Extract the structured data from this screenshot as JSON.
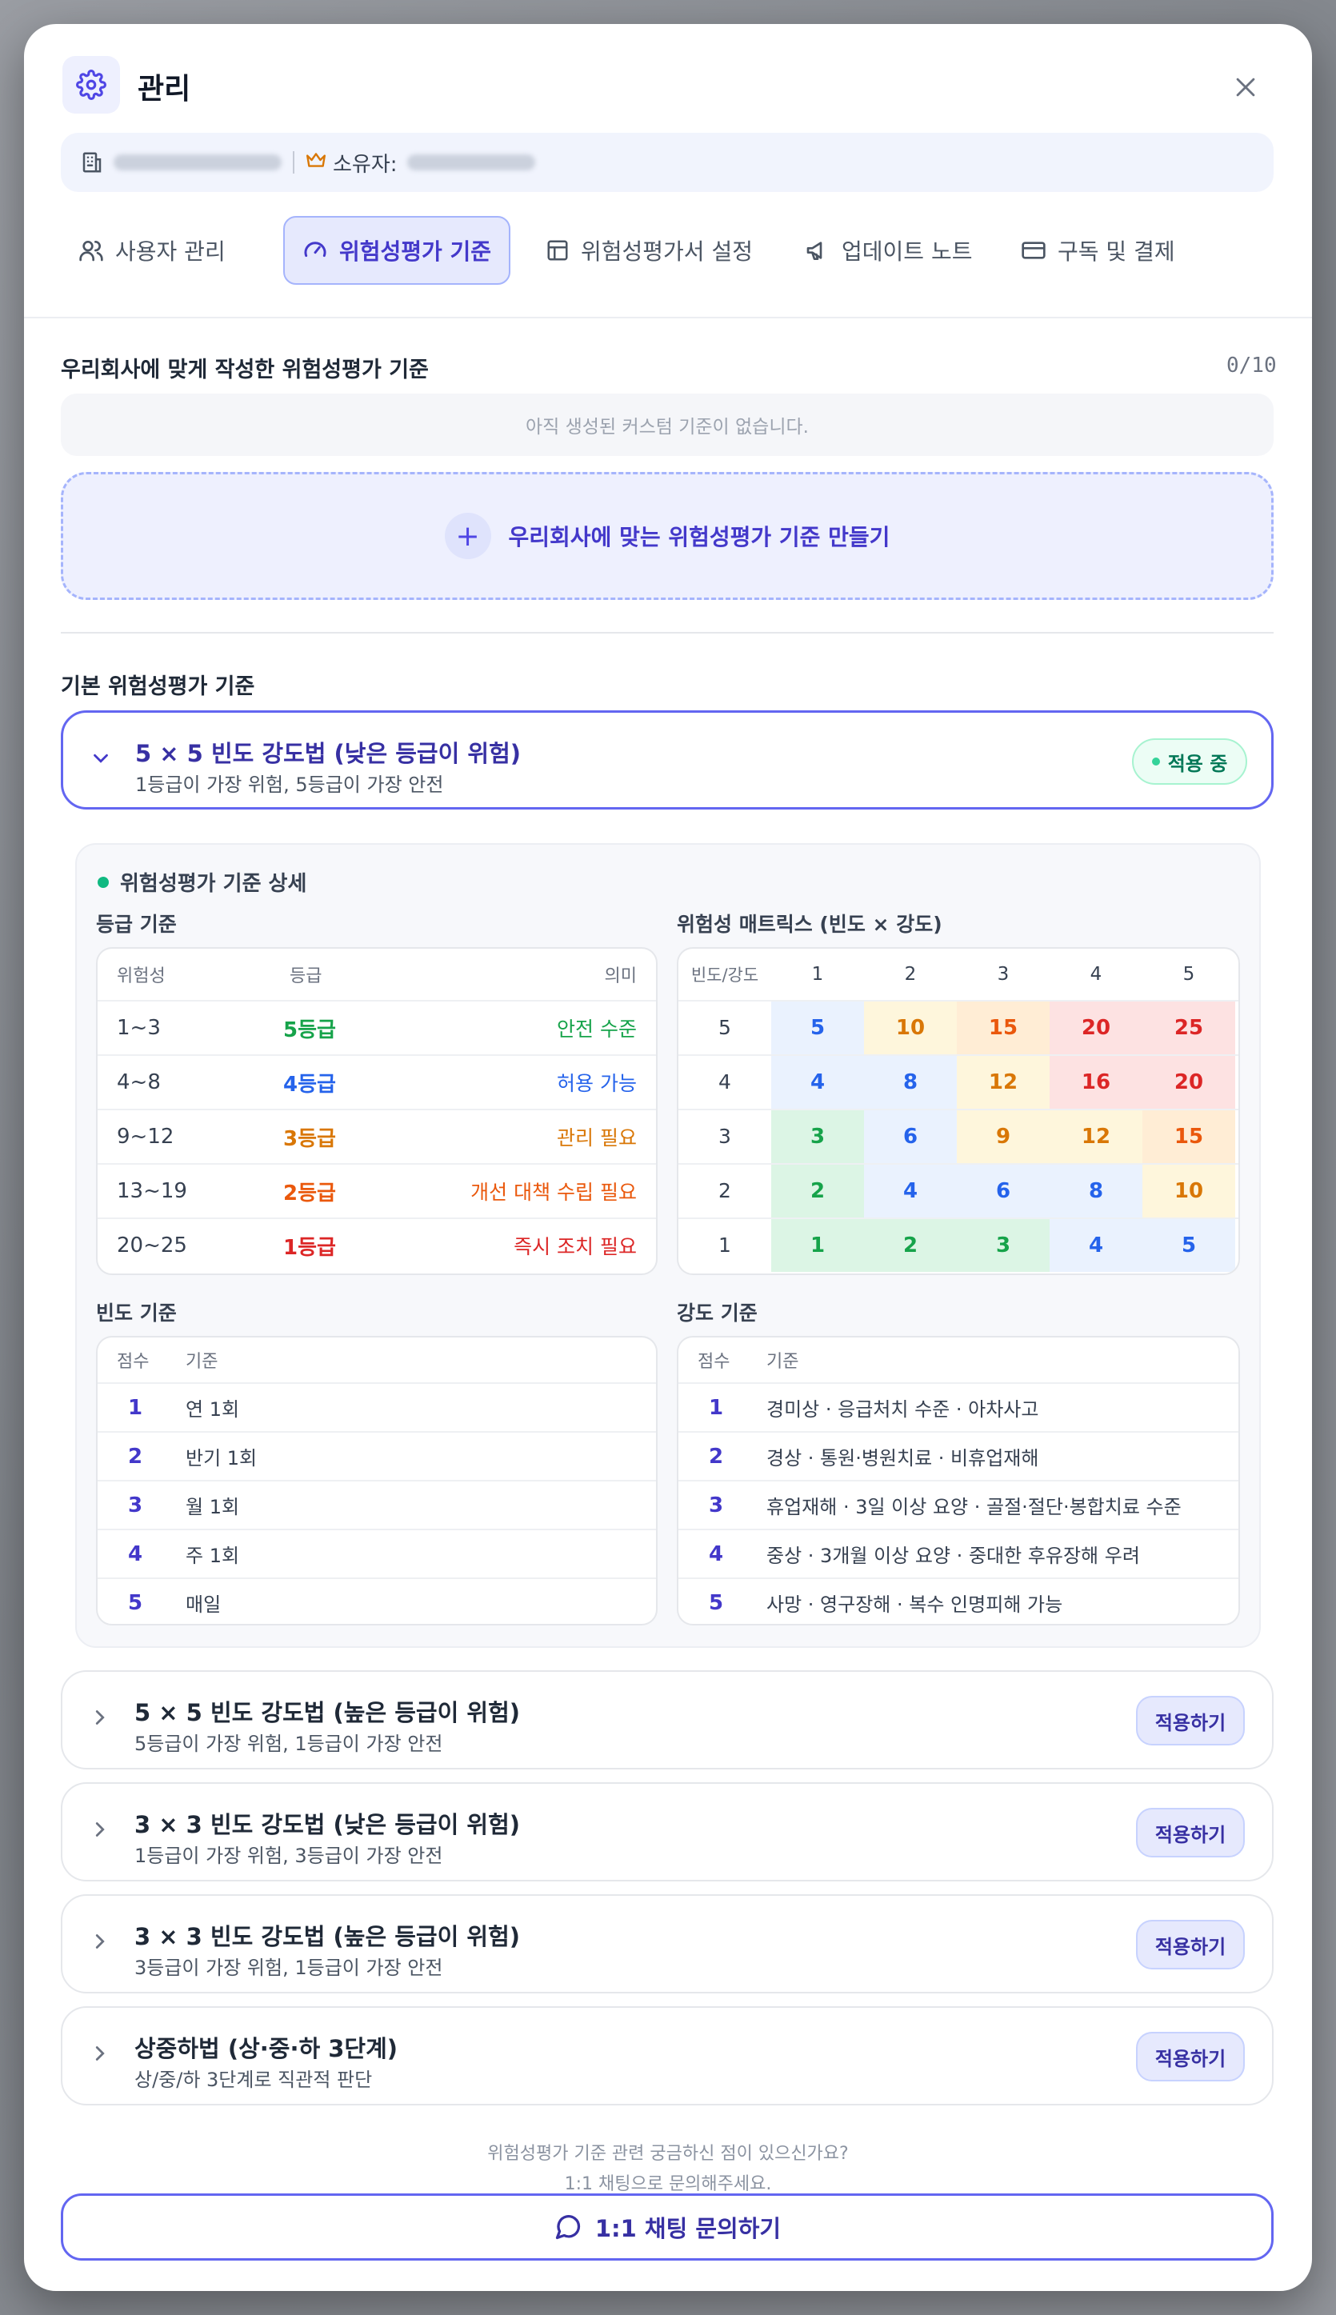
{
  "header": {
    "title": "관리",
    "icon": "gear-icon"
  },
  "org": {
    "owner_label": "소유자:"
  },
  "tabs": [
    {
      "label": "사용자 관리",
      "icon": "users-icon"
    },
    {
      "label": "위험성평가 기준",
      "icon": "gauge-icon",
      "active": true
    },
    {
      "label": "위험성평가서 설정",
      "icon": "table-icon"
    },
    {
      "label": "업데이트 노트",
      "icon": "megaphone-icon"
    },
    {
      "label": "구독 및 결제",
      "icon": "credit-card-icon"
    }
  ],
  "custom": {
    "title": "우리회사에 맞게 작성한 위험성평가 기준",
    "count": "0/10",
    "empty": "아직 생성된 커스텀 기준이 없습니다.",
    "create_label": "우리회사에 맞는 위험성평가 기준 만들기"
  },
  "basic_title": "기본 위험성평가 기준",
  "methods": [
    {
      "title": "5 × 5 빈도 강도법 (낮은 등급이 위험)",
      "subtitle": "1등급이 가장 위험, 5등급이 가장 안전",
      "status": "적용 중"
    },
    {
      "title": "5 × 5 빈도 강도법 (높은 등급이 위험)",
      "subtitle": "5등급이 가장 위험, 1등급이 가장 안전",
      "action": "적용하기"
    },
    {
      "title": "3 × 3 빈도 강도법 (낮은 등급이 위험)",
      "subtitle": "1등급이 가장 위험, 3등급이 가장 안전",
      "action": "적용하기"
    },
    {
      "title": "3 × 3 빈도 강도법 (높은 등급이 위험)",
      "subtitle": "3등급이 가장 위험, 1등급이 가장 안전",
      "action": "적용하기"
    },
    {
      "title": "상중하법 (상·중·하 3단계)",
      "subtitle": "상/중/하 3단계로 직관적 판단",
      "action": "적용하기"
    }
  ],
  "detail": {
    "title": "위험성평가 기준 상세",
    "grade": {
      "title": "등급 기준",
      "headers": [
        "위험성",
        "등급",
        "의미"
      ],
      "rows": [
        {
          "range": "1~3",
          "grade": "5등급",
          "meaning": "안전 수준",
          "color": "#16a34a"
        },
        {
          "range": "4~8",
          "grade": "4등급",
          "meaning": "허용 가능",
          "color": "#2563eb"
        },
        {
          "range": "9~12",
          "grade": "3등급",
          "meaning": "관리 필요",
          "color": "#d97706"
        },
        {
          "range": "13~19",
          "grade": "2등급",
          "meaning": "개선 대책 수립 필요",
          "color": "#ea580c"
        },
        {
          "range": "20~25",
          "grade": "1등급",
          "meaning": "즉시 조치 필요",
          "color": "#dc2626"
        }
      ]
    },
    "matrix": {
      "title": "위험성 매트릭스 (빈도 × 강도)",
      "corner": "빈도/강도",
      "cols": [
        "1",
        "2",
        "3",
        "4",
        "5"
      ],
      "rows": [
        {
          "freq": "5",
          "values": [
            "5",
            "10",
            "15",
            "20",
            "25"
          ]
        },
        {
          "freq": "4",
          "values": [
            "4",
            "8",
            "12",
            "16",
            "20"
          ]
        },
        {
          "freq": "3",
          "values": [
            "3",
            "6",
            "9",
            "12",
            "15"
          ]
        },
        {
          "freq": "2",
          "values": [
            "2",
            "4",
            "6",
            "8",
            "10"
          ]
        },
        {
          "freq": "1",
          "values": [
            "1",
            "2",
            "3",
            "4",
            "5"
          ]
        }
      ]
    },
    "frequency": {
      "title": "빈도 기준",
      "headers": [
        "점수",
        "기준"
      ],
      "rows": [
        {
          "score": "1",
          "desc": "연 1회"
        },
        {
          "score": "2",
          "desc": "반기 1회"
        },
        {
          "score": "3",
          "desc": "월 1회"
        },
        {
          "score": "4",
          "desc": "주 1회"
        },
        {
          "score": "5",
          "desc": "매일"
        }
      ]
    },
    "severity": {
      "title": "강도 기준",
      "headers": [
        "점수",
        "기준"
      ],
      "rows": [
        {
          "score": "1",
          "desc": "경미상 · 응급처치 수준 · 아차사고"
        },
        {
          "score": "2",
          "desc": "경상 · 통원·병원치료 · 비휴업재해"
        },
        {
          "score": "3",
          "desc": "휴업재해 · 3일 이상 요양 · 골절·절단·봉합치료 수준"
        },
        {
          "score": "4",
          "desc": "중상 · 3개월 이상 요양 · 중대한 후유장해 우려"
        },
        {
          "score": "5",
          "desc": "사망 · 영구장해 · 복수 인명피해 가능"
        }
      ]
    }
  },
  "footer": {
    "question": "위험성평가 기준 관련 궁금하신 점이 있으신가요?",
    "hint": "1:1 채팅으로 문의해주세요.",
    "chat_label": "1:1 채팅 문의하기"
  },
  "colors": {
    "accent": "#4f46e5",
    "active_border": "#6366f1"
  }
}
